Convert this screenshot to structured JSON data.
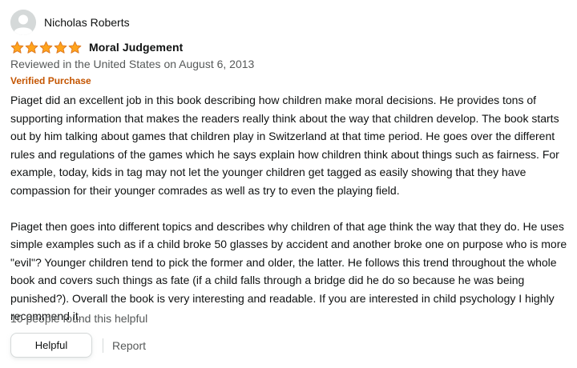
{
  "profile": {
    "name": "Nicholas Roberts",
    "avatar_icon": "default-profile-avatar-icon"
  },
  "rating": {
    "stars": 5,
    "max": 5,
    "star_color": "#ffa41c",
    "star_outline": "#de7921"
  },
  "review": {
    "title": "Moral Judgement",
    "date_line": "Reviewed in the United States on August 6, 2013",
    "verified": "Verified Purchase",
    "verified_color": "#c45500",
    "paragraphs": [
      "Piaget did an excellent job in this book describing how children make moral decisions. He provides tons of supporting information that makes the readers really think about the way that children develop. The book starts out by him talking about games that children play in Switzerland at that time period. He goes over the different rules and regulations of the games which he says explain how children think about things such as fairness. For example, today, kids in tag may not let the younger children get tagged as easily showing that they have compassion for their younger comrades as well as try to even the playing field.",
      "Piaget then goes into different topics and describes why children of that age think the way that they do. He uses simple examples such as if a child broke 50 glasses by accident and another broke one on purpose who is more \"evil\"? Younger children tend to pick the former and older, the latter. He follows this trend throughout the whole book and covers such things as fate (if a child falls through a bridge did he do so because he was being punished?). Overall the book is very interesting and readable. If you are interested in child psychology I highly recommend it."
    ]
  },
  "footer": {
    "helpful_count": "10 people found this helpful",
    "helpful_button": "Helpful",
    "report_link": "Report"
  }
}
